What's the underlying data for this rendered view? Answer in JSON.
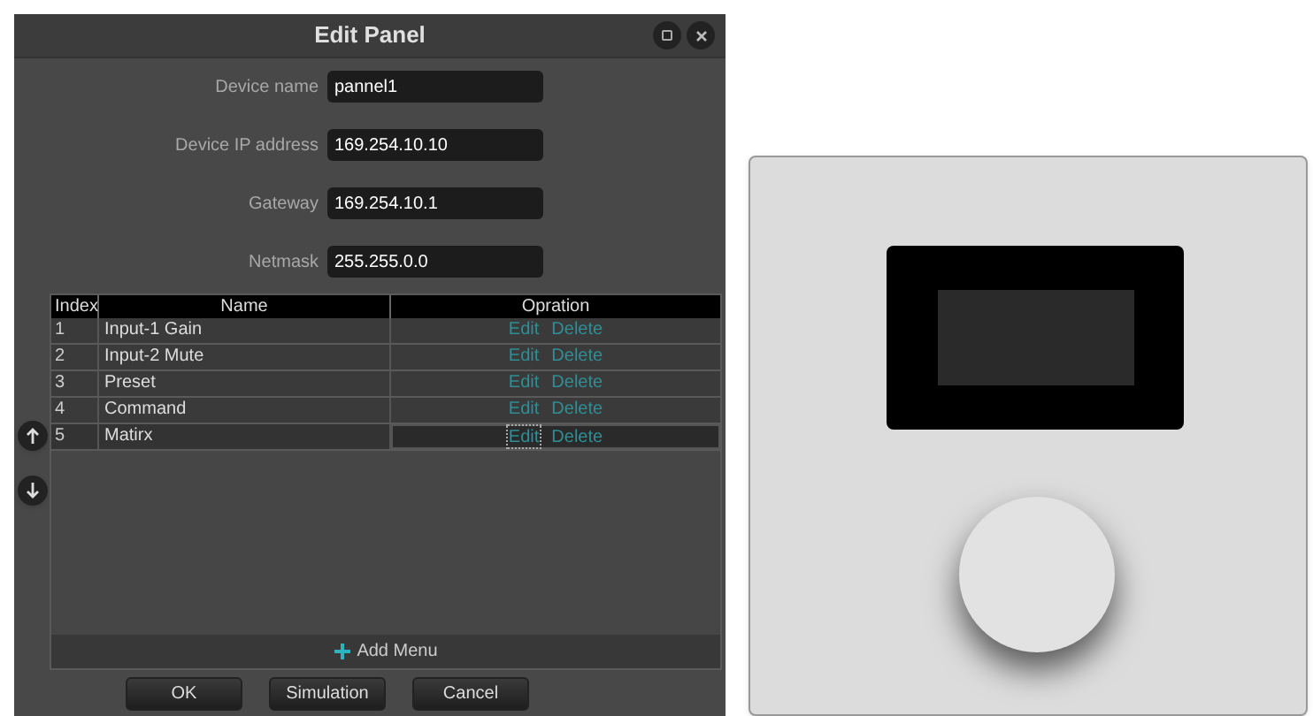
{
  "window": {
    "title": "Edit Panel"
  },
  "fields": [
    {
      "label": "Device name",
      "value": "pannel1"
    },
    {
      "label": "Device IP address",
      "value": "169.254.10.10"
    },
    {
      "label": "Gateway",
      "value": "169.254.10.1"
    },
    {
      "label": "Netmask",
      "value": "255.255.0.0"
    }
  ],
  "table": {
    "columns": [
      "Index",
      "Name",
      "Opration"
    ],
    "rows": [
      {
        "index": "1",
        "name": "Input-1 Gain",
        "edit": "Edit",
        "delete": "Delete",
        "selected": false
      },
      {
        "index": "2",
        "name": "Input-2 Mute",
        "edit": "Edit",
        "delete": "Delete",
        "selected": false
      },
      {
        "index": "3",
        "name": "Preset",
        "edit": "Edit",
        "delete": "Delete",
        "selected": false
      },
      {
        "index": "4",
        "name": "Command",
        "edit": "Edit",
        "delete": "Delete",
        "selected": false
      },
      {
        "index": "5",
        "name": "Matirx",
        "edit": "Edit",
        "delete": "Delete",
        "selected": true
      }
    ]
  },
  "add_menu": "Add Menu",
  "buttons": [
    "OK",
    "Simulation",
    "Cancel"
  ]
}
